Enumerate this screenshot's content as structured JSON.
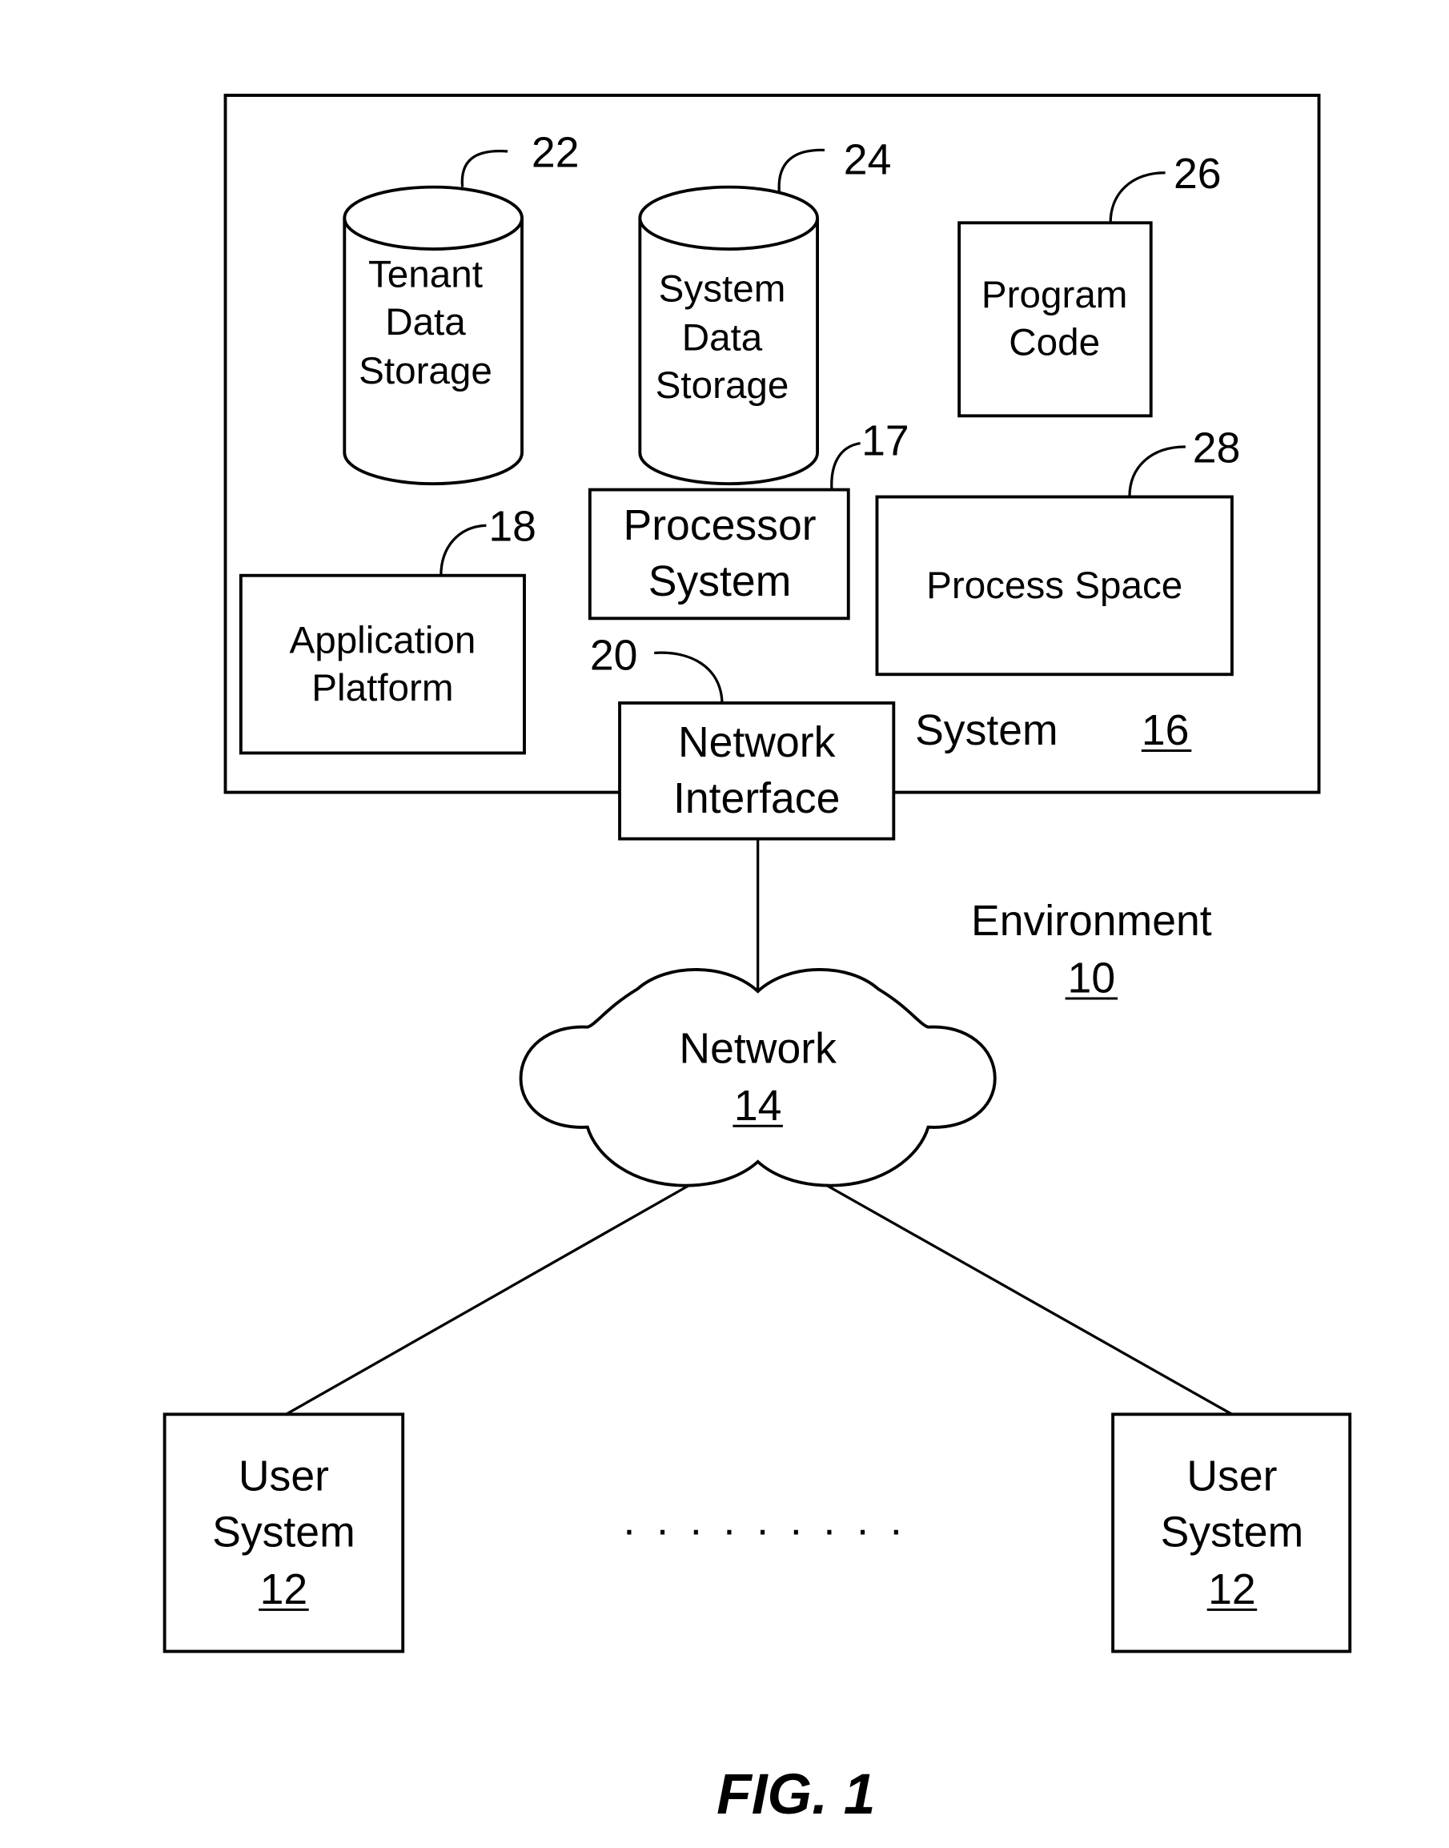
{
  "diagram": {
    "system": {
      "label": "System",
      "ref": "16"
    },
    "tenant_storage": {
      "lines": [
        "Tenant",
        "Data",
        "Storage"
      ],
      "ref": "22"
    },
    "system_storage": {
      "lines": [
        "System",
        "Data",
        "Storage"
      ],
      "ref": "24"
    },
    "program_code": {
      "lines": [
        "Program",
        "Code"
      ],
      "ref": "26"
    },
    "processor_system": {
      "lines": [
        "Processor",
        "System"
      ],
      "ref": "17"
    },
    "process_space": {
      "lines": [
        "Process Space"
      ],
      "ref": "28"
    },
    "application_platform": {
      "lines": [
        "Application",
        "Platform"
      ],
      "ref": "18"
    },
    "network_interface": {
      "lines": [
        "Network",
        "Interface"
      ],
      "ref": "20"
    },
    "environment": {
      "label": "Environment",
      "ref": "10"
    },
    "network": {
      "label": "Network",
      "ref": "14"
    },
    "user_systems": [
      {
        "lines": [
          "User",
          "System"
        ],
        "ref": "12"
      },
      {
        "lines": [
          "User",
          "System"
        ],
        "ref": "12"
      }
    ],
    "ellipsis": ". . . . . . . . .",
    "figure_caption": "FIG. 1"
  }
}
